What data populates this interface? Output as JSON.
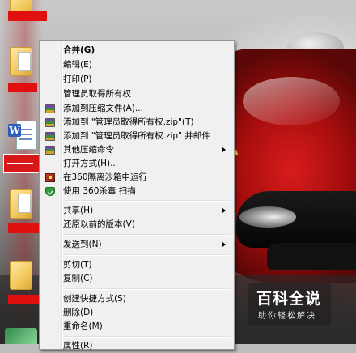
{
  "context_menu": {
    "items": [
      {
        "label": "合并(G)",
        "bold": true
      },
      {
        "label": "编辑(E)"
      },
      {
        "label": "打印(P)"
      },
      {
        "label": "管理员取得所有权"
      },
      {
        "label": "添加到压缩文件(A)...",
        "icon": "archive-icon"
      },
      {
        "label": "添加到 \"管理员取得所有权.zip\"(T)",
        "icon": "archive-icon"
      },
      {
        "label": "添加到 \"管理员取得所有权.zip\" 并邮件",
        "icon": "archive-icon"
      },
      {
        "label": "其他压缩命令",
        "icon": "archive-icon",
        "submenu": true
      },
      {
        "label": "打开方式(H)..."
      },
      {
        "label": "在360隔离沙箱中运行",
        "icon": "sandbox-icon"
      },
      {
        "label": "使用 360杀毒 扫描",
        "icon": "shield-icon"
      },
      {
        "label": "共享(H)",
        "submenu": true
      },
      {
        "label": "还原以前的版本(V)"
      },
      {
        "label": "发送到(N)",
        "submenu": true
      },
      {
        "label": "剪切(T)"
      },
      {
        "label": "复制(C)"
      },
      {
        "label": "创建快捷方式(S)"
      },
      {
        "label": "删除(D)"
      },
      {
        "label": "重命名(M)"
      },
      {
        "label": "属性(R)"
      }
    ]
  },
  "watermark": {
    "title": "百科全说",
    "subtitle": "助你轻松解决"
  },
  "colors": {
    "menu_background": "#f0f0f0",
    "selection_red": "#d81818",
    "car_red": "#c41515"
  }
}
